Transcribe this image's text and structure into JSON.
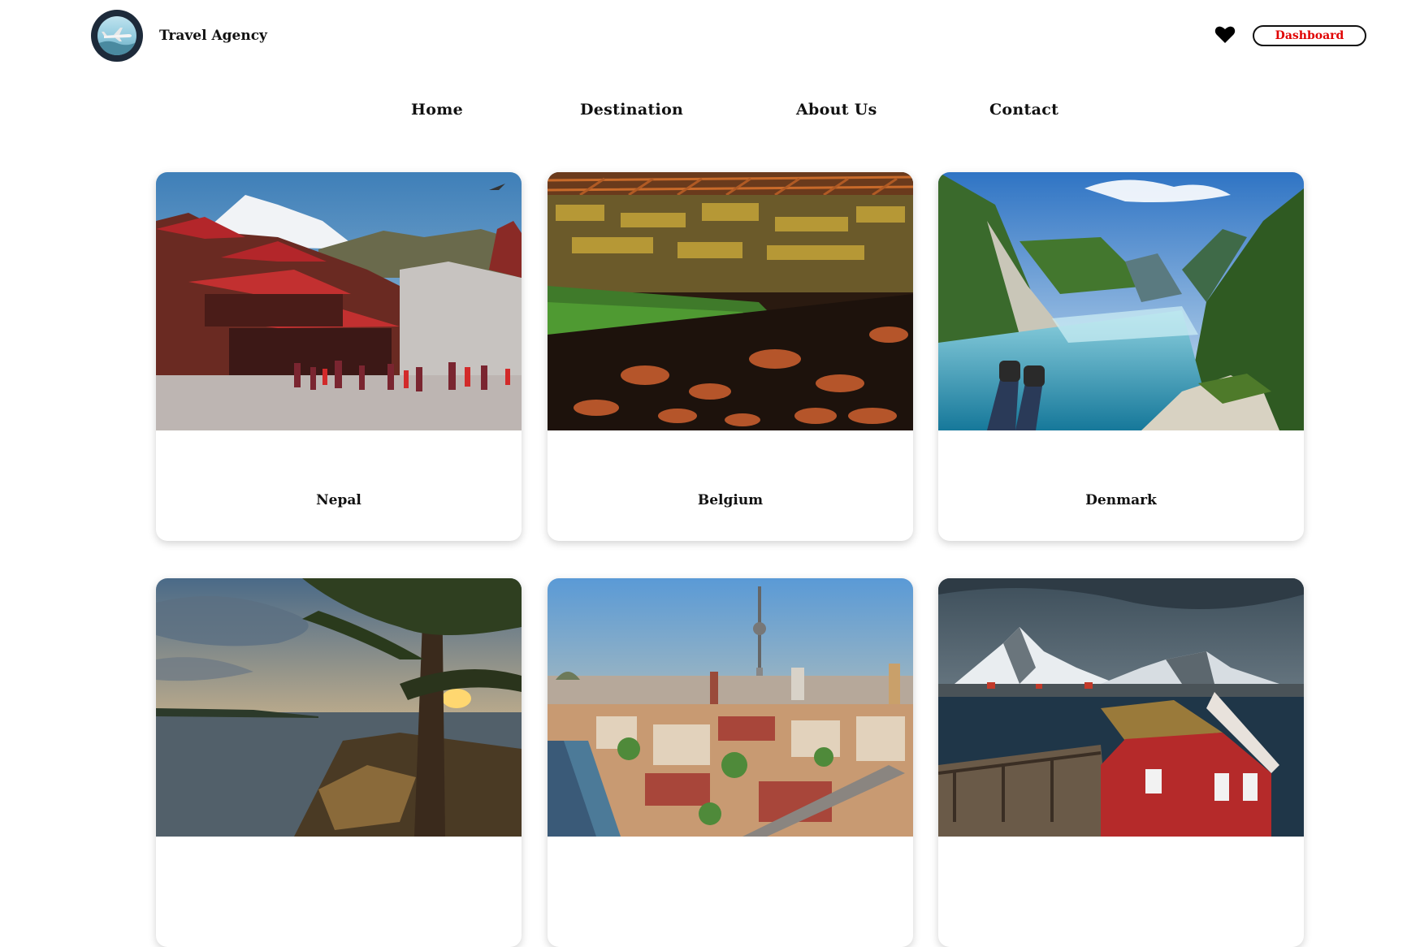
{
  "header": {
    "brand": "Travel Agency",
    "logo_icon": "plane-logo-icon",
    "favorites_icon": "heart-icon",
    "dashboard_label": "Dashboard",
    "accent_color": "#e00000"
  },
  "nav": {
    "items": [
      {
        "label": "Home"
      },
      {
        "label": "Destination"
      },
      {
        "label": "About Us"
      },
      {
        "label": "Contact"
      }
    ]
  },
  "destinations": [
    {
      "name": "Nepal",
      "image": "temple-mountain-photo"
    },
    {
      "name": "Belgium",
      "image": "stadium-crowd-photo"
    },
    {
      "name": "Denmark",
      "image": "fjord-cliff-photo"
    },
    {
      "name": "",
      "image": "lakeside-pine-sunset-photo"
    },
    {
      "name": "",
      "image": "city-tv-tower-photo"
    },
    {
      "name": "",
      "image": "red-cabin-mountains-photo"
    }
  ]
}
